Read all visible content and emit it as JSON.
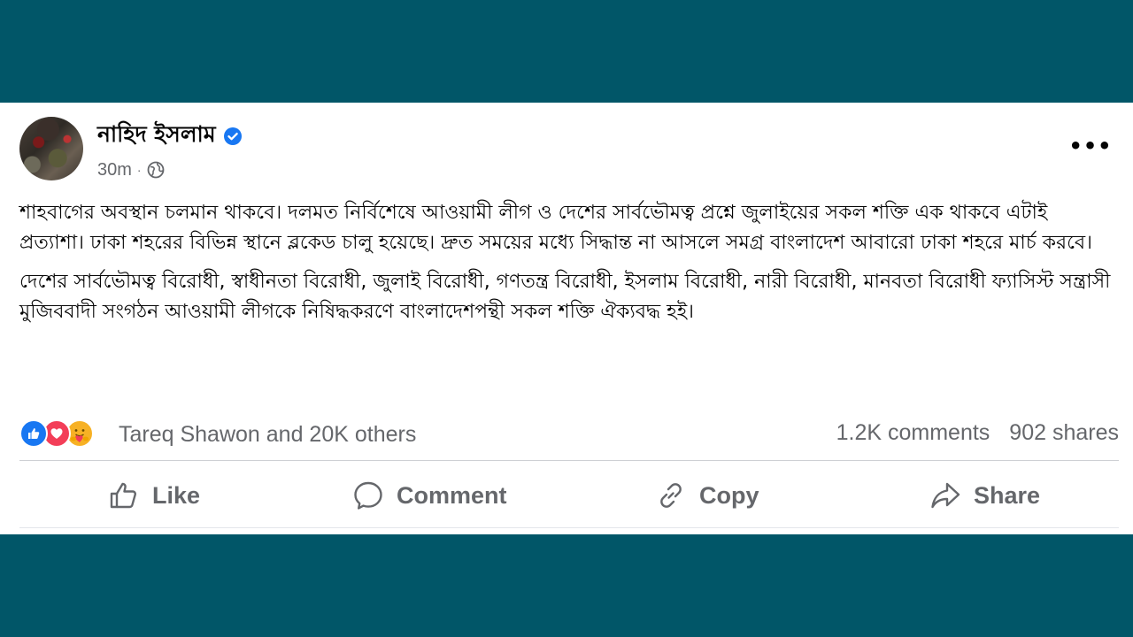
{
  "post": {
    "author": "নাহিদ ইসলাম",
    "time": "30m",
    "separator": "·",
    "more": "•••",
    "paragraphs": [
      "শাহবাগের অবস্থান চলমান থাকবে। দলমত নির্বিশেষে আওয়ামী লীগ ও দেশের সার্বভৌমত্ব প্রশ্নে জুলাইয়ের সকল শক্তি এক থাকবে এটাই প্রত্যাশা। ঢাকা শহরের বিভিন্ন স্থানে ব্লকেড চালু হয়েছে। দ্রুত সময়ের মধ্যে সিদ্ধান্ত না আসলে সমগ্র বাংলাদেশ আবারো ঢাকা শহরে মার্চ করবে।",
      "দেশের সার্বভৌমত্ব বিরোধী, স্বাধীনতা বিরোধী, জুলাই বিরোধী, গণতন্ত্র বিরোধী, ইসলাম বিরোধী, নারী বিরোধী, মানবতা বিরোধী ফ্যাসিস্ট সন্ত্রাসী মুজিববাদী সংগঠন আওয়ামী লীগকে নিষিদ্ধকরণে বাংলাদেশপন্থী সকল শক্তি ঐক্যবদ্ধ হই।"
    ]
  },
  "engagement": {
    "reactors": "Tareq Shawon and 20K others",
    "comments": "1.2K comments",
    "shares": "902 shares",
    "reaction_icons": [
      "like-icon",
      "love-icon",
      "care-icon"
    ]
  },
  "actions": {
    "like": "Like",
    "comment": "Comment",
    "copy": "Copy",
    "share": "Share"
  },
  "colors": {
    "background": "#015668",
    "card": "#ffffff",
    "muted_text": "#65676b",
    "verified": "#1877f2"
  }
}
